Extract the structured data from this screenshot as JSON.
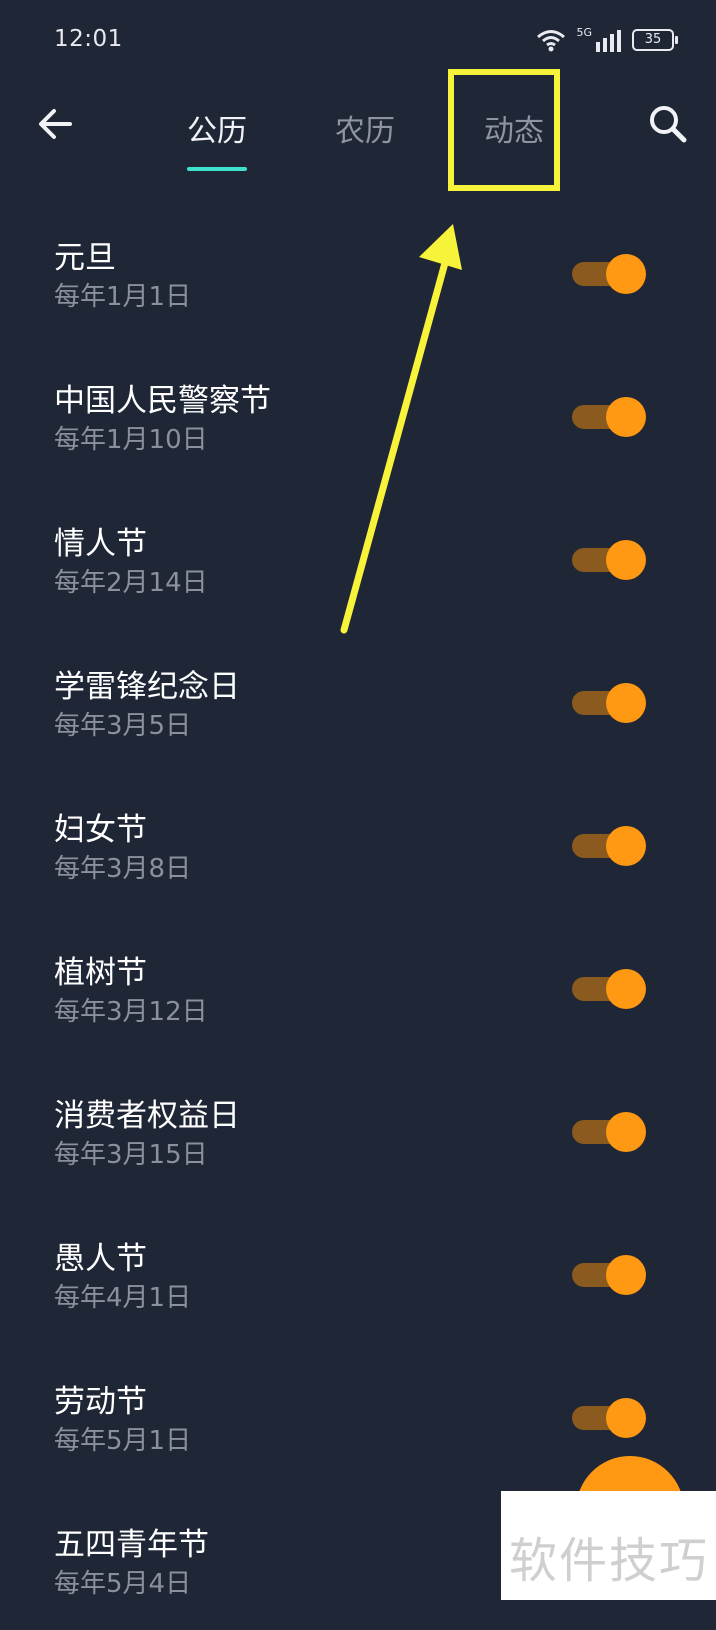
{
  "status_bar": {
    "time": "12:01",
    "network": "5G",
    "battery": "35"
  },
  "header": {
    "tabs": [
      {
        "label": "公历",
        "active": true
      },
      {
        "label": "农历",
        "active": false
      },
      {
        "label": "动态",
        "active": false
      }
    ],
    "back_icon": "arrow-left-icon",
    "search_icon": "search-icon"
  },
  "holidays": [
    {
      "name": "元旦",
      "date": "每年1月1日",
      "enabled": true
    },
    {
      "name": "中国人民警察节",
      "date": "每年1月10日",
      "enabled": true
    },
    {
      "name": "情人节",
      "date": "每年2月14日",
      "enabled": true
    },
    {
      "name": "学雷锋纪念日",
      "date": "每年3月5日",
      "enabled": true
    },
    {
      "name": "妇女节",
      "date": "每年3月8日",
      "enabled": true
    },
    {
      "name": "植树节",
      "date": "每年3月12日",
      "enabled": true
    },
    {
      "name": "消费者权益日",
      "date": "每年3月15日",
      "enabled": true
    },
    {
      "name": "愚人节",
      "date": "每年4月1日",
      "enabled": true
    },
    {
      "name": "劳动节",
      "date": "每年5月1日",
      "enabled": true
    },
    {
      "name": "五四青年节",
      "date": "每年5月4日",
      "enabled": true
    }
  ],
  "watermark": {
    "text": "软件技巧"
  },
  "colors": {
    "background": "#1f2636",
    "accent": "#3fe1cc",
    "toggle_on": "#ff9812",
    "annotation": "#f7f23a"
  }
}
